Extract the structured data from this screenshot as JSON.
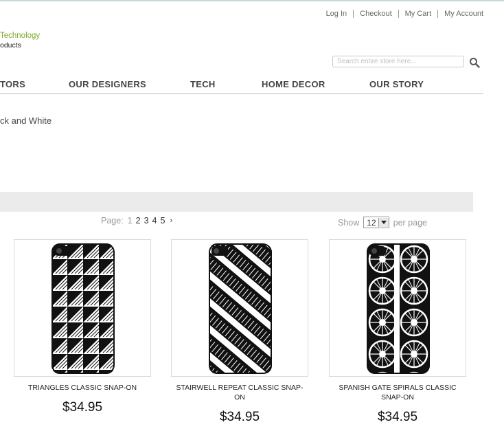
{
  "header": {
    "links": [
      "Log In",
      "Checkout",
      "My Cart",
      "My Account"
    ],
    "logo_line1": "Technology",
    "logo_line2": "oducts"
  },
  "search": {
    "placeholder": "Search entire store here..."
  },
  "nav": {
    "items": [
      "TORS",
      "OUR DESIGNERS",
      "TECH",
      "HOME DECOR",
      "OUR STORY"
    ]
  },
  "category": {
    "title": "ck and White"
  },
  "toolbar": {
    "page_label": "Page:",
    "pages": [
      "1",
      "2",
      "3",
      "4",
      "5"
    ],
    "next": "›",
    "show_label": "Show",
    "per_page_value": "12",
    "per_page_suffix": "per page"
  },
  "products": [
    {
      "name": "TRIANGLES CLASSIC SNAP-ON",
      "price": "$34.95"
    },
    {
      "name": "STAIRWELL REPEAT CLASSIC SNAP-ON",
      "price": "$34.95"
    },
    {
      "name": "SPANISH GATE SPIRALS CLASSIC SNAP-ON",
      "price": "$34.95"
    }
  ],
  "colors": {
    "logo_green": "#7dab2a",
    "band": "#ebebeb"
  },
  "icons": {
    "search": "search-icon",
    "dropdown": "chevron-down-icon",
    "next": "chevron-right-icon"
  }
}
